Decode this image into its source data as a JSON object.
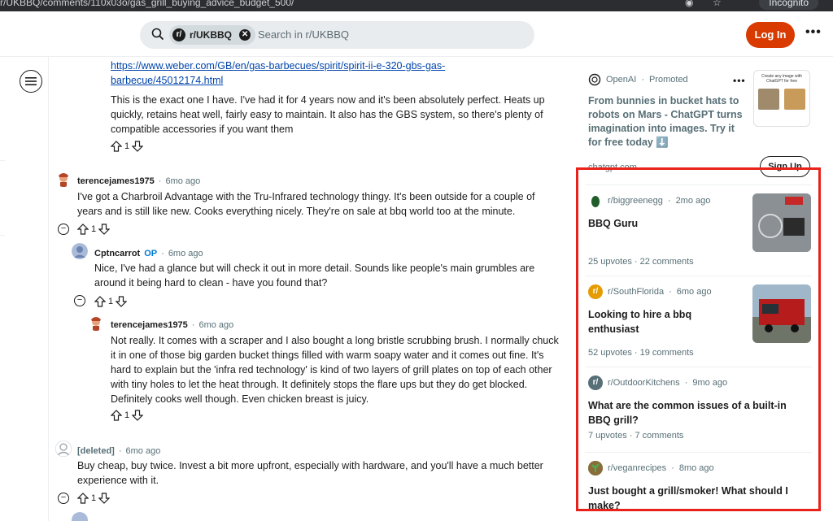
{
  "browser": {
    "url": "r/UKBBQ/comments/110x03o/gas_grill_buying_advice_budget_500/",
    "incognito_label": "Incognito"
  },
  "header": {
    "community_chip": "r/UKBBQ",
    "community_avatar_letter": "r/",
    "search_placeholder": "Search in r/UKBBQ",
    "login_label": "Log In",
    "more_label": "•••"
  },
  "comments": {
    "link": "https://www.weber.com/GB/en/gas-barbecues/spirit/spirit-ii-e-320-gbs-gas-barbecue/45012174.html",
    "first_body": "This is the exact one I have. I've had it for 4 years now and it's been absolutely perfect. Heats up quickly, retains heat well, fairly easy to maintain. It also has the GBS system, so there's plenty of compatible accessories if you want them",
    "first_votes": "1",
    "c1": {
      "user": "terencejames1975",
      "time": "6mo ago",
      "body": "I've got a Charbroil Advantage with the Tru-Infrared technology thingy. It's been outside for a couple of years and is still like new. Cooks everything nicely. They're on sale at bbq world too at the minute.",
      "votes": "1"
    },
    "c2": {
      "user": "Cptncarrot",
      "op": "OP",
      "time": "6mo ago",
      "body": "Nice, I've had a glance but will check it out in more detail. Sounds like people's main grumbles are around it being hard to clean - have you found that?",
      "votes": "1"
    },
    "c3": {
      "user": "terencejames1975",
      "time": "6mo ago",
      "body": "Not really. It comes with a scraper and I also bought a long bristle scrubbing brush. I normally chuck it in one of those big garden bucket things filled with warm soapy water and it comes out fine. It's hard to explain but the 'infra red technology' is kind of two layers of grill plates on top of each other with tiny holes to let the heat through. It definitely stops the flare ups but they do get blocked. Definitely cooks well though. Even chicken breast is juicy.",
      "votes": "1"
    },
    "c4": {
      "user": "[deleted]",
      "time": "6mo ago",
      "body": "Buy cheap, buy twice. Invest a bit more upfront, especially with hardware, and you'll have a much better experience with it.",
      "votes": "1"
    }
  },
  "sidebar": {
    "ad": {
      "advertiser": "OpenAI",
      "promoted": "Promoted",
      "title": "From bunnies in bucket hats to robots on Mars - ChatGPT turns imagination into images. Try it for free today ⬇️",
      "thumb_caption": "Create any image with ChatGPT for free",
      "domain": "chatgpt.com",
      "signup_label": "Sign Up",
      "dots": "•••"
    },
    "posts": [
      {
        "sub": "r/biggreenegg",
        "time": "2mo ago",
        "title": "BBQ Guru",
        "upvotes": "25 upvotes",
        "comments": "22 comments",
        "avatar_color": "#2e7d32",
        "avatar_letter": ""
      },
      {
        "sub": "r/SouthFlorida",
        "time": "6mo ago",
        "title": "Looking to hire a bbq enthusiast",
        "upvotes": "52 upvotes",
        "comments": "19 comments",
        "avatar_color": "#e69b00",
        "avatar_letter": "r/"
      },
      {
        "sub": "r/OutdoorKitchens",
        "time": "9mo ago",
        "title": "What are the common issues of a built-in BBQ grill?",
        "upvotes": "7 upvotes",
        "comments": "7 comments",
        "avatar_color": "#576f76",
        "avatar_letter": "r/"
      },
      {
        "sub": "r/veganrecipes",
        "time": "8mo ago",
        "title": "Just bought a grill/smoker! What should I make?",
        "upvotes": "",
        "comments": "",
        "avatar_color": "#6d8b3a",
        "avatar_letter": ""
      }
    ],
    "sep": "·"
  }
}
